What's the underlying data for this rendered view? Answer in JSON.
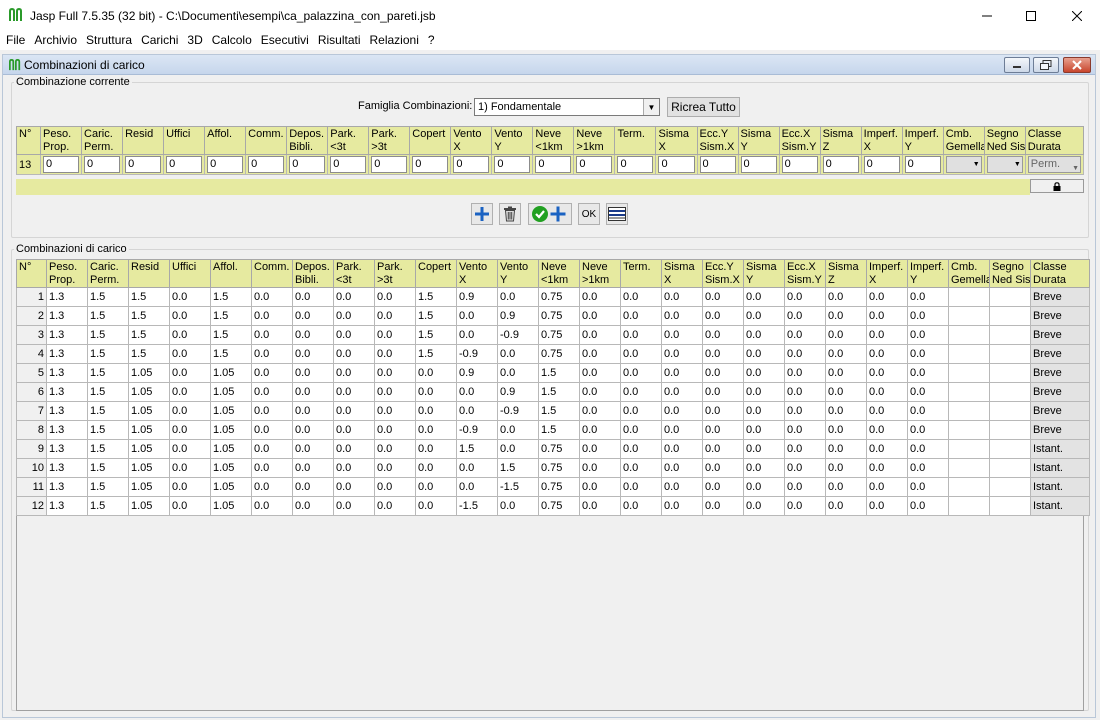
{
  "window": {
    "title": "Jasp Full 7.5.35 (32 bit)  - C:\\Documenti\\esempi\\ca_palazzina_con_pareti.jsb"
  },
  "menu": [
    "File",
    "Archivio",
    "Struttura",
    "Carichi",
    "3D",
    "Calcolo",
    "Esecutivi",
    "Risultati",
    "Relazioni",
    "?"
  ],
  "frame": {
    "title": "Combinazioni di carico"
  },
  "current": {
    "legend": "Combinazione corrente",
    "famiglia_label": "Famiglia Combinazioni:",
    "famiglia_value": "1) Fondamentale",
    "ricrea_label": "Ricrea Tutto",
    "row_number": "13",
    "values": [
      "0",
      "0",
      "0",
      "0",
      "0",
      "0",
      "0",
      "0",
      "0",
      "0",
      "0",
      "0",
      "0",
      "0",
      "0",
      "0",
      "0",
      "0",
      "0",
      "0",
      "0",
      "0"
    ],
    "classe": "Perm."
  },
  "columns": [
    {
      "l1": "N°",
      "l2": ""
    },
    {
      "l1": "Peso.",
      "l2": "Prop."
    },
    {
      "l1": "Caric.",
      "l2": "Perm."
    },
    {
      "l1": "Resid",
      "l2": ""
    },
    {
      "l1": "Uffici",
      "l2": ""
    },
    {
      "l1": "Affol.",
      "l2": ""
    },
    {
      "l1": "Comm.",
      "l2": ""
    },
    {
      "l1": "Depos.",
      "l2": "Bibli."
    },
    {
      "l1": "Park.",
      "l2": "<3t"
    },
    {
      "l1": "Park.",
      "l2": ">3t"
    },
    {
      "l1": "Copert",
      "l2": ""
    },
    {
      "l1": "Vento",
      "l2": "X"
    },
    {
      "l1": "Vento",
      "l2": "Y"
    },
    {
      "l1": "Neve",
      "l2": "<1km"
    },
    {
      "l1": "Neve",
      "l2": ">1km"
    },
    {
      "l1": "Term.",
      "l2": ""
    },
    {
      "l1": "Sisma",
      "l2": "X"
    },
    {
      "l1": "Ecc.Y",
      "l2": "Sism.X"
    },
    {
      "l1": "Sisma",
      "l2": "Y"
    },
    {
      "l1": "Ecc.X",
      "l2": "Sism.Y"
    },
    {
      "l1": "Sisma",
      "l2": "Z"
    },
    {
      "l1": "Imperf.",
      "l2": "X"
    },
    {
      "l1": "Imperf.",
      "l2": "Y"
    },
    {
      "l1": "Cmb.",
      "l2": "Gemella"
    },
    {
      "l1": "Segno",
      "l2": "Ned Sism"
    },
    {
      "l1": "Classe",
      "l2": "Durata"
    }
  ],
  "list": {
    "legend": "Combinazioni di carico",
    "rows": [
      [
        "1",
        "1.3",
        "1.5",
        "1.5",
        "0.0",
        "1.5",
        "0.0",
        "0.0",
        "0.0",
        "0.0",
        "1.5",
        "0.9",
        "0.0",
        "0.75",
        "0.0",
        "0.0",
        "0.0",
        "0.0",
        "0.0",
        "0.0",
        "0.0",
        "0.0",
        "0.0",
        "",
        "",
        "Breve"
      ],
      [
        "2",
        "1.3",
        "1.5",
        "1.5",
        "0.0",
        "1.5",
        "0.0",
        "0.0",
        "0.0",
        "0.0",
        "1.5",
        "0.0",
        "0.9",
        "0.75",
        "0.0",
        "0.0",
        "0.0",
        "0.0",
        "0.0",
        "0.0",
        "0.0",
        "0.0",
        "0.0",
        "",
        "",
        "Breve"
      ],
      [
        "3",
        "1.3",
        "1.5",
        "1.5",
        "0.0",
        "1.5",
        "0.0",
        "0.0",
        "0.0",
        "0.0",
        "1.5",
        "0.0",
        "-0.9",
        "0.75",
        "0.0",
        "0.0",
        "0.0",
        "0.0",
        "0.0",
        "0.0",
        "0.0",
        "0.0",
        "0.0",
        "",
        "",
        "Breve"
      ],
      [
        "4",
        "1.3",
        "1.5",
        "1.5",
        "0.0",
        "1.5",
        "0.0",
        "0.0",
        "0.0",
        "0.0",
        "1.5",
        "-0.9",
        "0.0",
        "0.75",
        "0.0",
        "0.0",
        "0.0",
        "0.0",
        "0.0",
        "0.0",
        "0.0",
        "0.0",
        "0.0",
        "",
        "",
        "Breve"
      ],
      [
        "5",
        "1.3",
        "1.5",
        "1.05",
        "0.0",
        "1.05",
        "0.0",
        "0.0",
        "0.0",
        "0.0",
        "0.0",
        "0.9",
        "0.0",
        "1.5",
        "0.0",
        "0.0",
        "0.0",
        "0.0",
        "0.0",
        "0.0",
        "0.0",
        "0.0",
        "0.0",
        "",
        "",
        "Breve"
      ],
      [
        "6",
        "1.3",
        "1.5",
        "1.05",
        "0.0",
        "1.05",
        "0.0",
        "0.0",
        "0.0",
        "0.0",
        "0.0",
        "0.0",
        "0.9",
        "1.5",
        "0.0",
        "0.0",
        "0.0",
        "0.0",
        "0.0",
        "0.0",
        "0.0",
        "0.0",
        "0.0",
        "",
        "",
        "Breve"
      ],
      [
        "7",
        "1.3",
        "1.5",
        "1.05",
        "0.0",
        "1.05",
        "0.0",
        "0.0",
        "0.0",
        "0.0",
        "0.0",
        "0.0",
        "-0.9",
        "1.5",
        "0.0",
        "0.0",
        "0.0",
        "0.0",
        "0.0",
        "0.0",
        "0.0",
        "0.0",
        "0.0",
        "",
        "",
        "Breve"
      ],
      [
        "8",
        "1.3",
        "1.5",
        "1.05",
        "0.0",
        "1.05",
        "0.0",
        "0.0",
        "0.0",
        "0.0",
        "0.0",
        "-0.9",
        "0.0",
        "1.5",
        "0.0",
        "0.0",
        "0.0",
        "0.0",
        "0.0",
        "0.0",
        "0.0",
        "0.0",
        "0.0",
        "",
        "",
        "Breve"
      ],
      [
        "9",
        "1.3",
        "1.5",
        "1.05",
        "0.0",
        "1.05",
        "0.0",
        "0.0",
        "0.0",
        "0.0",
        "0.0",
        "1.5",
        "0.0",
        "0.75",
        "0.0",
        "0.0",
        "0.0",
        "0.0",
        "0.0",
        "0.0",
        "0.0",
        "0.0",
        "0.0",
        "",
        "",
        "Istant."
      ],
      [
        "10",
        "1.3",
        "1.5",
        "1.05",
        "0.0",
        "1.05",
        "0.0",
        "0.0",
        "0.0",
        "0.0",
        "0.0",
        "0.0",
        "1.5",
        "0.75",
        "0.0",
        "0.0",
        "0.0",
        "0.0",
        "0.0",
        "0.0",
        "0.0",
        "0.0",
        "0.0",
        "",
        "",
        "Istant."
      ],
      [
        "11",
        "1.3",
        "1.5",
        "1.05",
        "0.0",
        "1.05",
        "0.0",
        "0.0",
        "0.0",
        "0.0",
        "0.0",
        "0.0",
        "-1.5",
        "0.75",
        "0.0",
        "0.0",
        "0.0",
        "0.0",
        "0.0",
        "0.0",
        "0.0",
        "0.0",
        "0.0",
        "",
        "",
        "Istant."
      ],
      [
        "12",
        "1.3",
        "1.5",
        "1.05",
        "0.0",
        "1.05",
        "0.0",
        "0.0",
        "0.0",
        "0.0",
        "0.0",
        "-1.5",
        "0.0",
        "0.75",
        "0.0",
        "0.0",
        "0.0",
        "0.0",
        "0.0",
        "0.0",
        "0.0",
        "0.0",
        "0.0",
        "",
        "",
        "Istant."
      ]
    ]
  },
  "icons": {
    "app": "jasp-logo-icon",
    "toolbar": [
      "add-icon",
      "delete-trash-icon",
      "confirm-add-icon",
      "ok-button",
      "table-lines-icon"
    ],
    "ok_label": "OK"
  },
  "colors": {
    "header": "#e6eaa0",
    "accent": "#1a62c2",
    "confirm": "#21a021"
  }
}
